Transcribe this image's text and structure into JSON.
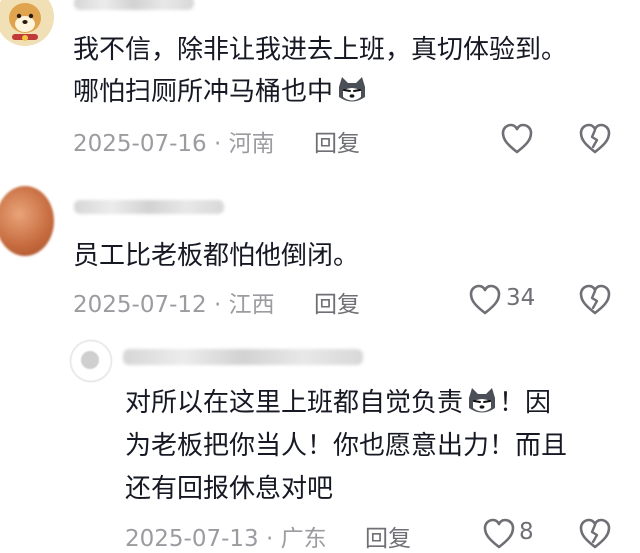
{
  "comments": [
    {
      "lines": [
        "我不信，除非让我进去上班，真切体验到。",
        "哪怕扫厕所冲马桶也中"
      ],
      "emoji": "husky-sticker",
      "date": "2025-07-16",
      "sep": "·",
      "location": "河南",
      "reply_label": "回复",
      "like_count": ""
    },
    {
      "lines": [
        "员工比老板都怕他倒闭。"
      ],
      "date": "2025-07-12",
      "sep": "·",
      "location": "江西",
      "reply_label": "回复",
      "like_count": "34"
    }
  ],
  "reply": {
    "line1_a": "对所以在这里上班都自觉负责",
    "line1_b": "！因",
    "line2": "为老板把你当人！你也愿意出力！而且",
    "line3": "还有回报休息对吧",
    "emoji": "husky-sticker",
    "date": "2025-07-13",
    "sep": "·",
    "location": "广东",
    "reply_label": "回复",
    "like_count": "8"
  },
  "icons": {
    "like": "heart-outline-icon",
    "dislike": "broken-heart-outline-icon"
  }
}
